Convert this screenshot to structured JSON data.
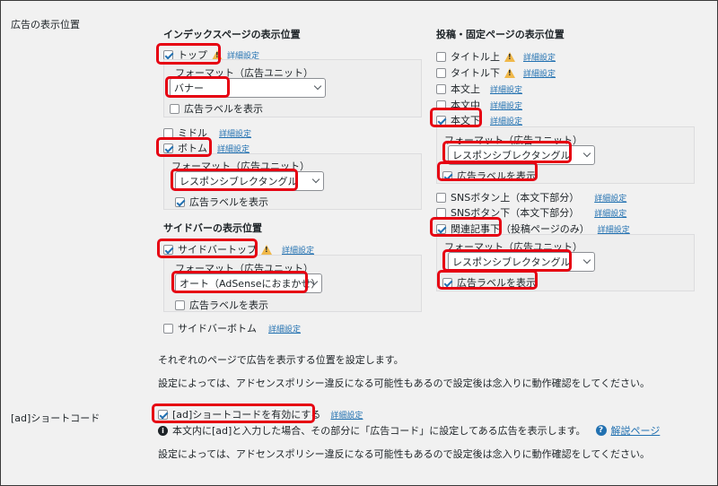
{
  "ad_position": {
    "row_label": "広告の表示位置",
    "index": {
      "heading": "インデックスページの表示位置",
      "top": {
        "label": "トップ",
        "link": "詳細設定",
        "format_label": "フォーマット（広告ユニット）",
        "format_value": "バナー",
        "ad_label": "広告ラベルを表示"
      },
      "middle": {
        "label": "ミドル",
        "link": "詳細設定"
      },
      "bottom": {
        "label": "ボトム",
        "link": "詳細設定",
        "format_label": "フォーマット（広告ユニット）",
        "format_value": "レスポンシブレクタングル",
        "ad_label": "広告ラベルを表示"
      }
    },
    "sidebar": {
      "heading": "サイドバーの表示位置",
      "top": {
        "label": "サイドバートップ",
        "link": "詳細設定",
        "format_label": "フォーマット（広告ユニット）",
        "format_value": "オート（AdSenseにおまかせ）",
        "ad_label": "広告ラベルを表示"
      },
      "bottom": {
        "label": "サイドバーボトム",
        "link": "詳細設定"
      }
    },
    "post": {
      "heading": "投稿・固定ページの表示位置",
      "title_top": {
        "label": "タイトル上",
        "link": "詳細設定"
      },
      "title_bottom": {
        "label": "タイトル下",
        "link": "詳細設定"
      },
      "content_top": {
        "label": "本文上",
        "link": "詳細設定"
      },
      "content_middle": {
        "label": "本文中",
        "link": "詳細設定"
      },
      "content_bottom": {
        "label": "本文下",
        "link": "詳細設定",
        "format_label": "フォーマット（広告ユニット）",
        "format_value": "レスポンシブレクタングル",
        "ad_label": "広告ラベルを表示"
      },
      "sns_top": {
        "label": "SNSボタン上（本文下部分）",
        "link": "詳細設定"
      },
      "sns_bottom": {
        "label": "SNSボタン下（本文下部分）",
        "link": "詳細設定"
      },
      "related": {
        "label": "関連記事下",
        "suffix": "（投稿ページのみ）",
        "link": "詳細設定",
        "format_label": "フォーマット（広告ユニット）",
        "format_value": "レスポンシブレクタングル",
        "ad_label": "広告ラベルを表示"
      }
    },
    "desc1": "それぞれのページで広告を表示する位置を設定します。",
    "desc2": "設定によっては、アドセンスポリシー違反になる可能性もあるので設定後は念入りに動作確認をしてください。"
  },
  "shortcode": {
    "row_label": "[ad]ショートコード",
    "checkbox_label": "[ad]ショートコードを有効にする",
    "link": "詳細設定",
    "info_text": "本文内に[ad]と入力した場合、その部分に「広告コード」に設定してある広告を表示します。",
    "help_link": "解説ページ",
    "desc": "設定によっては、アドセンスポリシー違反になる可能性もあるので設定後は念入りに動作確認をしてください。"
  },
  "colors": {
    "highlight": "#e60012",
    "link": "#2271b1",
    "checkbox": "#2271b1",
    "background": "#f1f1f1"
  }
}
